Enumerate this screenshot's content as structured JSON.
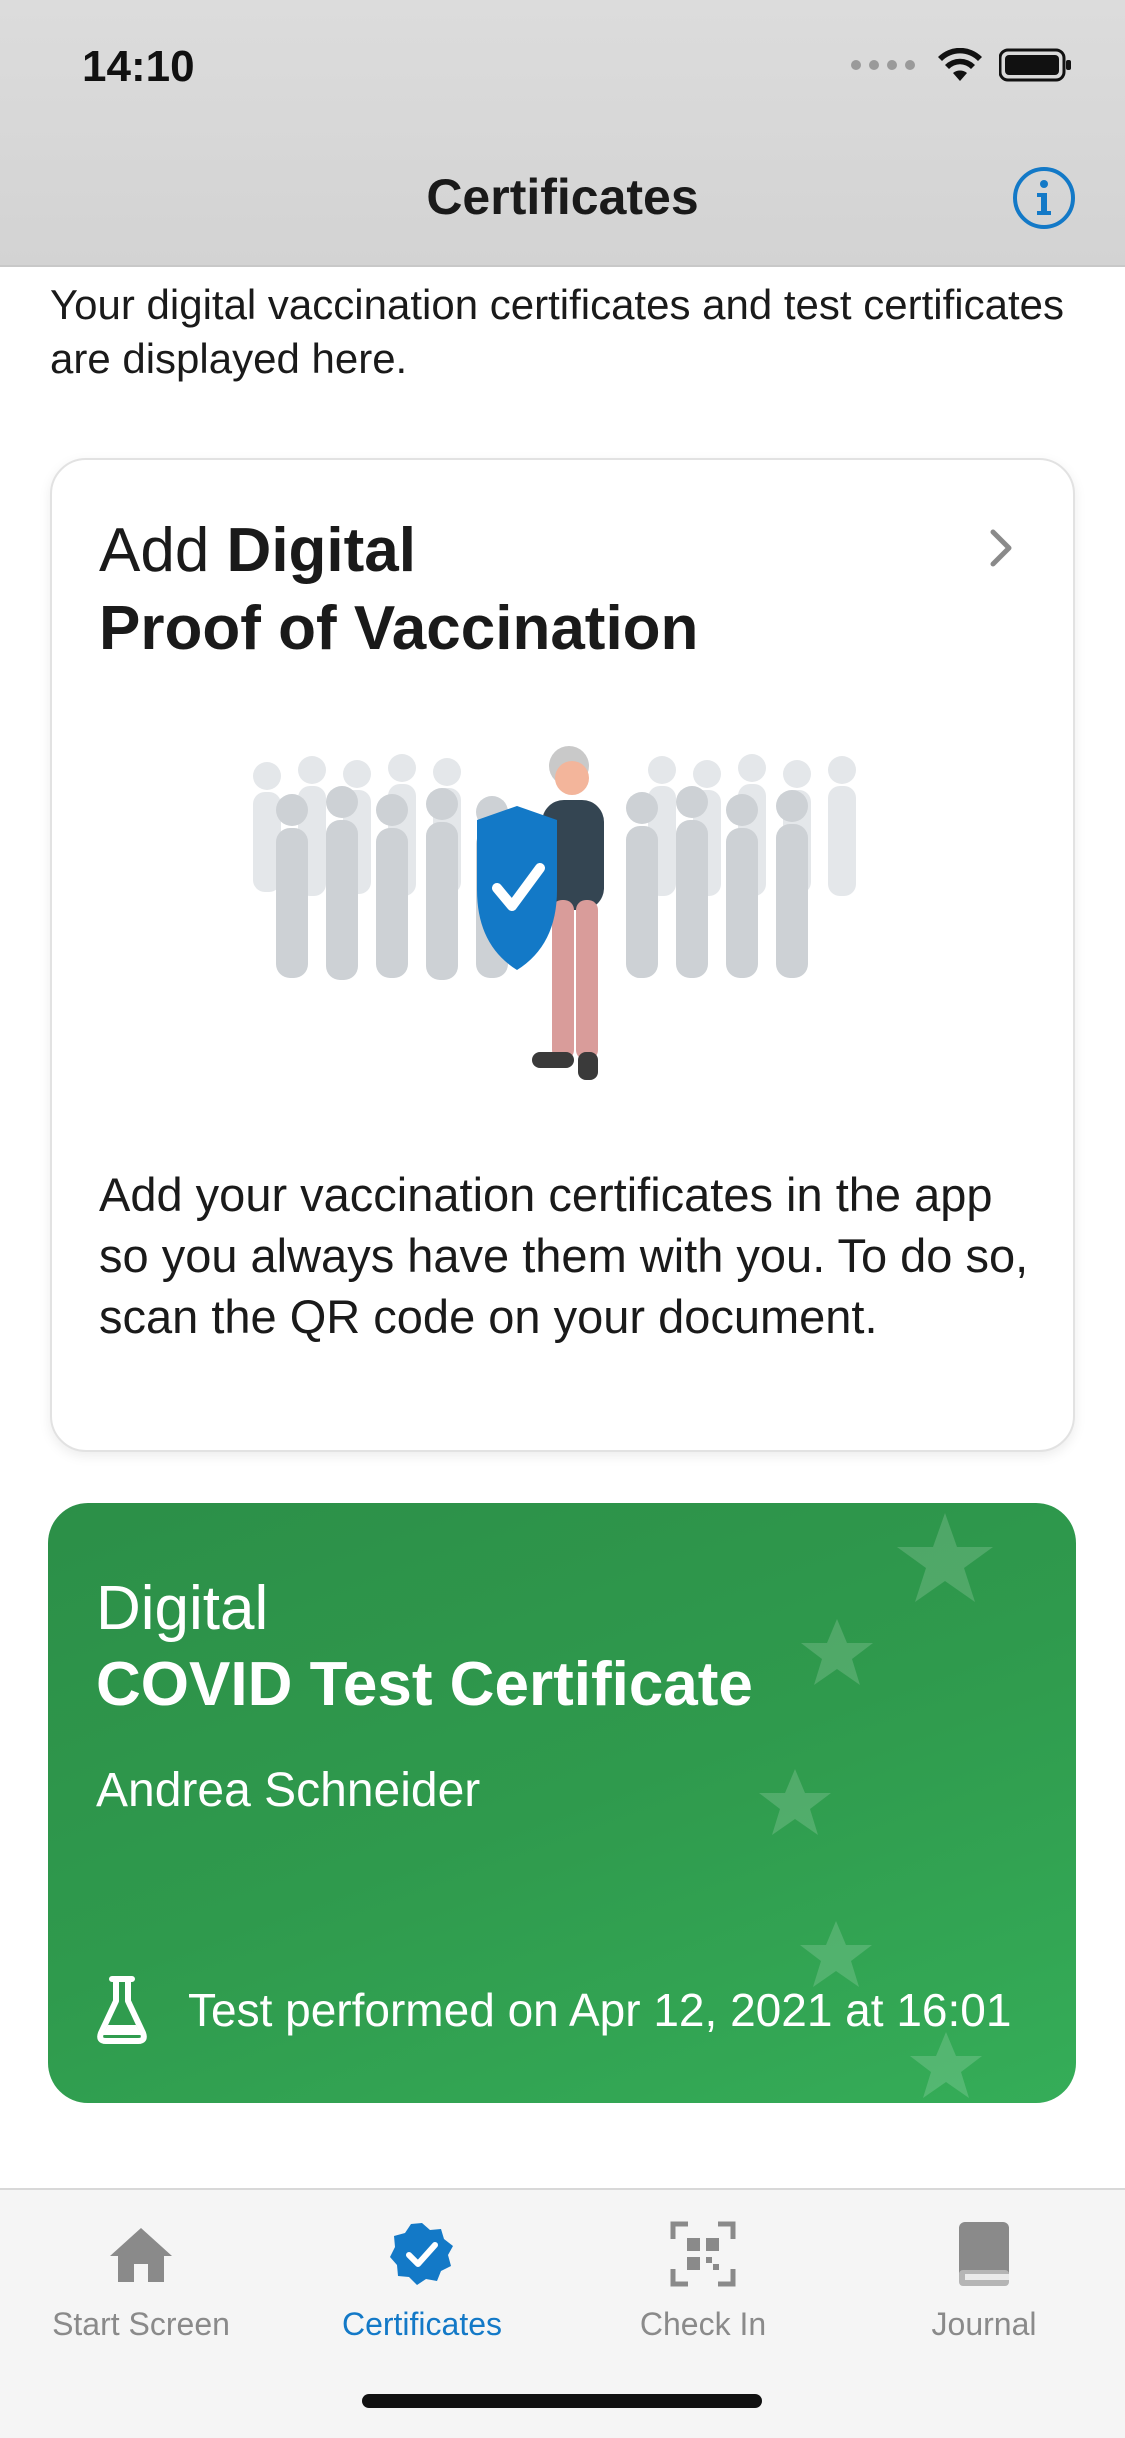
{
  "status_bar": {
    "time": "14:10"
  },
  "nav": {
    "title": "Certificates",
    "info_icon": "info-circle-icon"
  },
  "intro_text": "Your digital vaccination certificates and test certificates are displayed here.",
  "vaccination_card": {
    "title_light": "Add ",
    "title_bold_1": "Digital",
    "title_bold_2": "Proof of Vaccination",
    "body": "Add your vaccination certificates in the app so you always have them with you. To do so, scan the QR code on your document."
  },
  "test_card": {
    "label": "Digital",
    "title": "COVID Test Certificate",
    "name": "Andrea Schneider",
    "date_text": "Test performed on Apr 12, 2021 at 16:01",
    "color": "#2f9a4d"
  },
  "tabbar": {
    "tabs": [
      {
        "label": "Start Screen",
        "icon": "home-icon",
        "active": false
      },
      {
        "label": "Certificates",
        "icon": "certificate-check-icon",
        "active": true
      },
      {
        "label": "Check In",
        "icon": "qr-scan-icon",
        "active": false
      },
      {
        "label": "Journal",
        "icon": "book-icon",
        "active": false
      }
    ]
  },
  "colors": {
    "accent": "#1379c7",
    "green": "#2f9a4d"
  }
}
